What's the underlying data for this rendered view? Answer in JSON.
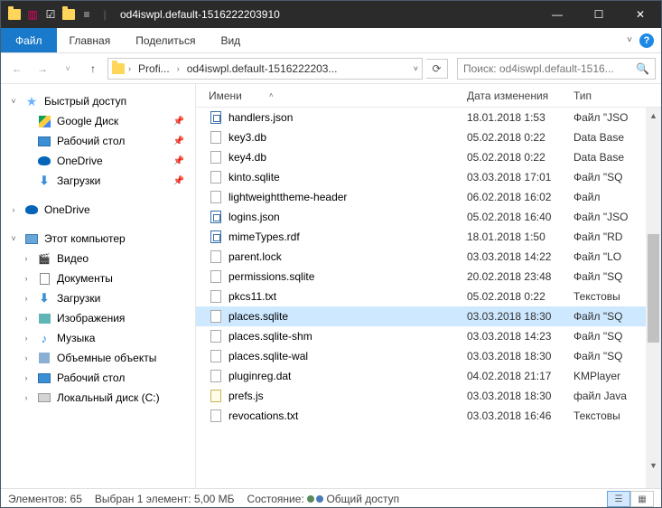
{
  "titlebar": {
    "title": "od4iswpl.default-1516222203910"
  },
  "ribbon": {
    "file": "Файл",
    "tabs": [
      "Главная",
      "Поделиться",
      "Вид"
    ]
  },
  "address": {
    "crumbs": [
      "Profi...",
      "od4iswpl.default-1516222203..."
    ]
  },
  "search": {
    "placeholder": "Поиск: od4iswpl.default-1516..."
  },
  "nav": {
    "quick": {
      "label": "Быстрый доступ",
      "items": [
        {
          "label": "Google Диск",
          "icon": "gd"
        },
        {
          "label": "Рабочий стол",
          "icon": "desk"
        },
        {
          "label": "OneDrive",
          "icon": "od"
        },
        {
          "label": "Загрузки",
          "icon": "dl"
        }
      ]
    },
    "onedrive": {
      "label": "OneDrive"
    },
    "pc": {
      "label": "Этот компьютер",
      "items": [
        {
          "label": "Видео",
          "icon": "vid"
        },
        {
          "label": "Документы",
          "icon": "doc"
        },
        {
          "label": "Загрузки",
          "icon": "dl"
        },
        {
          "label": "Изображения",
          "icon": "img"
        },
        {
          "label": "Музыка",
          "icon": "mus"
        },
        {
          "label": "Объемные объекты",
          "icon": "obj"
        },
        {
          "label": "Рабочий стол",
          "icon": "desk"
        },
        {
          "label": "Локальный диск (C:)",
          "icon": "drv"
        }
      ]
    }
  },
  "columns": {
    "name": "Имени",
    "date": "Дата изменения",
    "type": "Тип"
  },
  "files": [
    {
      "name": "handlers.json",
      "date": "18.01.2018 1:53",
      "type": "Файл \"JSO",
      "icon": "json"
    },
    {
      "name": "key3.db",
      "date": "05.02.2018 0:22",
      "type": "Data Base",
      "icon": "blank"
    },
    {
      "name": "key4.db",
      "date": "05.02.2018 0:22",
      "type": "Data Base",
      "icon": "blank"
    },
    {
      "name": "kinto.sqlite",
      "date": "03.03.2018 17:01",
      "type": "Файл \"SQ",
      "icon": "blank"
    },
    {
      "name": "lightweighttheme-header",
      "date": "06.02.2018 16:02",
      "type": "Файл",
      "icon": "blank"
    },
    {
      "name": "logins.json",
      "date": "05.02.2018 16:40",
      "type": "Файл \"JSO",
      "icon": "json"
    },
    {
      "name": "mimeTypes.rdf",
      "date": "18.01.2018 1:50",
      "type": "Файл \"RD",
      "icon": "json"
    },
    {
      "name": "parent.lock",
      "date": "03.03.2018 14:22",
      "type": "Файл \"LO",
      "icon": "blank"
    },
    {
      "name": "permissions.sqlite",
      "date": "20.02.2018 23:48",
      "type": "Файл \"SQ",
      "icon": "blank"
    },
    {
      "name": "pkcs11.txt",
      "date": "05.02.2018 0:22",
      "type": "Текстовы",
      "icon": "blank"
    },
    {
      "name": "places.sqlite",
      "date": "03.03.2018 18:30",
      "type": "Файл \"SQ",
      "icon": "blank",
      "selected": true
    },
    {
      "name": "places.sqlite-shm",
      "date": "03.03.2018 14:23",
      "type": "Файл \"SQ",
      "icon": "blank"
    },
    {
      "name": "places.sqlite-wal",
      "date": "03.03.2018 18:30",
      "type": "Файл \"SQ",
      "icon": "blank"
    },
    {
      "name": "pluginreg.dat",
      "date": "04.02.2018 21:17",
      "type": "KMPlayer",
      "icon": "blank"
    },
    {
      "name": "prefs.js",
      "date": "03.03.2018 18:30",
      "type": "файл Java",
      "icon": "js"
    },
    {
      "name": "revocations.txt",
      "date": "03.03.2018 16:46",
      "type": "Текстовы",
      "icon": "blank"
    }
  ],
  "status": {
    "count_label": "Элементов:",
    "count": "65",
    "sel_label": "Выбран 1 элемент: 5,00 МБ",
    "state_label": "Состояние:",
    "share": "Общий доступ"
  }
}
